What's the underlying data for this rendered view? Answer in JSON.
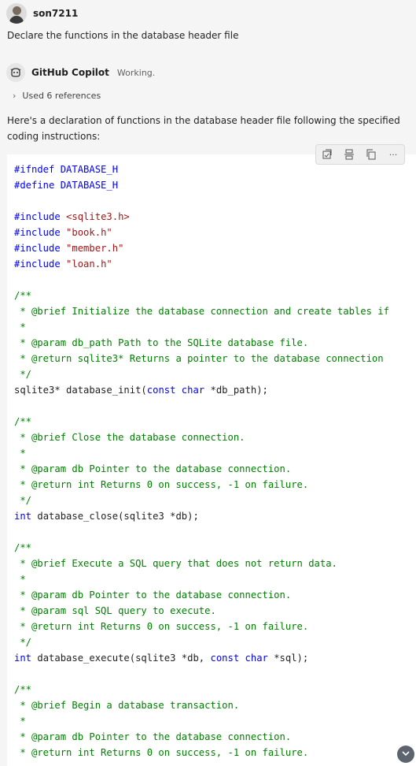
{
  "user": {
    "name": "son7211",
    "message": "Declare the functions in the database header file"
  },
  "bot": {
    "name": "GitHub Copilot",
    "status": "Working.",
    "references": "Used 6 references"
  },
  "intro_text": "Here's a declaration of functions in the database header file following the specified coding instructions:",
  "toolbar": {
    "apply_icon": "apply-in-editor-icon",
    "insert_icon": "insert-at-cursor-icon",
    "copy_icon": "copy-icon",
    "more_label": "···"
  },
  "colors": {
    "keyword": "#0000ff",
    "string": "#a31515",
    "comment": "#008000",
    "text": "#1f1f1f"
  },
  "code": {
    "l0": "#ifndef DATABASE_H",
    "l1": "#define DATABASE_H",
    "l3a": "#include ",
    "l3b": "<sqlite3.h>",
    "l4a": "#include ",
    "l4b": "\"book.h\"",
    "l5a": "#include ",
    "l5b": "\"member.h\"",
    "l6a": "#include ",
    "l6b": "\"loan.h\"",
    "l8": "/**",
    "l9": " * @brief Initialize the database connection and create tables if",
    "l10": " *",
    "l11": " * @param db_path Path to the SQLite database file.",
    "l12": " * @return sqlite3* Returns a pointer to the database connection",
    "l13": " */",
    "l14a": "sqlite3* database_init(",
    "l14b": "const",
    "l14c": " ",
    "l14d": "char",
    "l14e": " *db_path);",
    "l16": "/**",
    "l17": " * @brief Close the database connection.",
    "l18": " *",
    "l19": " * @param db Pointer to the database connection.",
    "l20": " * @return int Returns 0 on success, -1 on failure.",
    "l21": " */",
    "l22a": "int",
    "l22b": " database_close(sqlite3 *db);",
    "l24": "/**",
    "l25": " * @brief Execute a SQL query that does not return data.",
    "l26": " *",
    "l27": " * @param db Pointer to the database connection.",
    "l28": " * @param sql SQL query to execute.",
    "l29": " * @return int Returns 0 on success, -1 on failure.",
    "l30": " */",
    "l31a": "int",
    "l31b": " database_execute(sqlite3 *db, ",
    "l31c": "const",
    "l31d": " ",
    "l31e": "char",
    "l31f": " *sql);",
    "l33": "/**",
    "l34": " * @brief Begin a database transaction.",
    "l35": " *",
    "l36": " * @param db Pointer to the database connection.",
    "l37": " * @return int Returns 0 on success, -1 on failure."
  }
}
